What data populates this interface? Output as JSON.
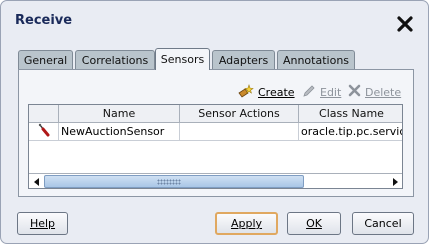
{
  "dialog": {
    "title": "Receive",
    "close_icon": "close-icon"
  },
  "tabs": [
    {
      "label": "General",
      "active": false
    },
    {
      "label": "Correlations",
      "active": false
    },
    {
      "label": "Sensors",
      "active": true
    },
    {
      "label": "Adapters",
      "active": false
    },
    {
      "label": "Annotations",
      "active": false
    }
  ],
  "toolbar": {
    "create": {
      "label": "Create",
      "icon": "create-sensor-icon",
      "enabled": true
    },
    "edit": {
      "label": "Edit",
      "icon": "pencil-icon",
      "enabled": false
    },
    "delete": {
      "label": "Delete",
      "icon": "delete-x-icon",
      "enabled": false
    }
  },
  "table": {
    "columns": [
      "",
      "Name",
      "Sensor Actions",
      "Class Name"
    ],
    "rows": [
      {
        "icon": "sensor-probe-icon",
        "name": "NewAuctionSensor",
        "sensor_actions": "",
        "class_name": "oracle.tip.pc.services"
      }
    ]
  },
  "buttons": {
    "help": "Help",
    "apply": "Apply",
    "ok": "OK",
    "cancel": "Cancel"
  },
  "colors": {
    "dialog_background": "#e9ecf3",
    "title_color": "#1a2a5a",
    "default_button_border": "#e0a860",
    "scroll_thumb": "#a9c6e6"
  }
}
